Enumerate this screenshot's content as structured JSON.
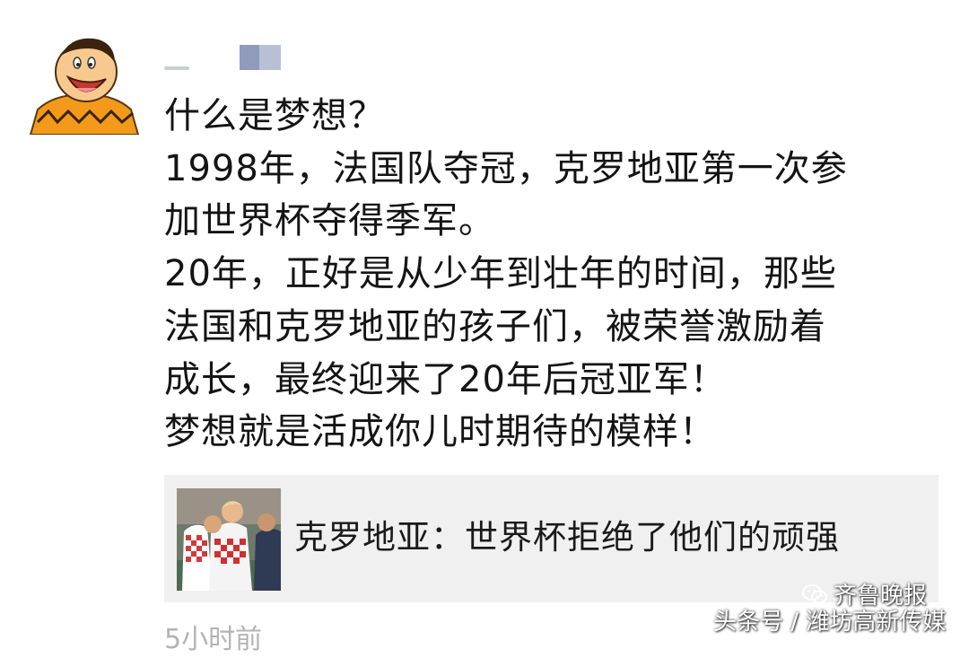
{
  "post": {
    "lines": [
      "什么是梦想？",
      "1998年，法国队夺冠，克罗地亚第一次参",
      "加世界杯夺得季军。",
      "20年，正好是从少年到壮年的时间，那些",
      "法国和克罗地亚的孩子们，被荣誉激励着",
      "成长，最终迎来了20年后冠亚军！",
      "梦想就是活成你儿时期待的模样！"
    ],
    "timestamp": "5小时前"
  },
  "link_card": {
    "title": "克罗地亚：世界杯拒绝了他们的顽强"
  },
  "watermark": {
    "line1": "齐鲁晚报",
    "line2": "头条号 / 潍坊高新传媒"
  },
  "colors": {
    "text": "#141414",
    "card_bg": "#f0f0f0",
    "timestamp": "#b3b3b3",
    "avatar_shirt": "#f39a1a"
  },
  "icons": [
    "avatar",
    "thumbnail-image",
    "wechat-icon"
  ]
}
